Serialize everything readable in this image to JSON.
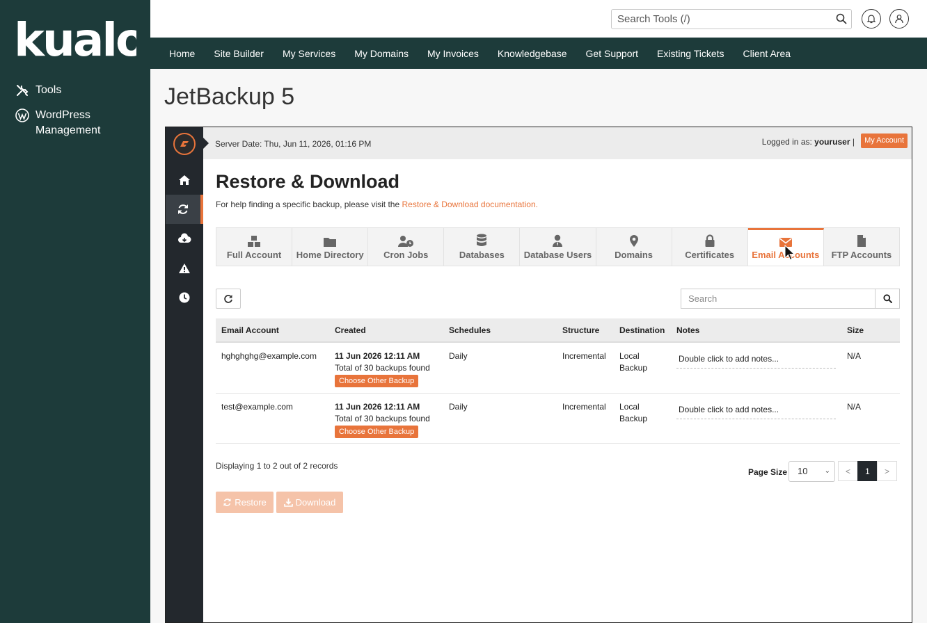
{
  "brand": {
    "logo_text": "kualo"
  },
  "sidebar": {
    "items": [
      {
        "label": "Tools",
        "icon": "tools-icon"
      },
      {
        "label": "WordPress Management",
        "icon": "wordpress-icon"
      }
    ]
  },
  "header": {
    "search_placeholder": "Search Tools (/)"
  },
  "nav": [
    "Home",
    "Site Builder",
    "My Services",
    "My Domains",
    "My Invoices",
    "Knowledgebase",
    "Get Support",
    "Existing Tickets",
    "Client Area"
  ],
  "page": {
    "title": "JetBackup 5"
  },
  "jetbackup": {
    "server_date": "Server Date: Thu, Jun 11, 2026, 01:16 PM",
    "logged_in_prefix": "Logged in as:",
    "username": "youruser",
    "separator": "|",
    "my_account": "My Account",
    "heading": "Restore & Download",
    "help_text": "For help finding a specific backup, please visit the",
    "help_link": "Restore & Download documentation.",
    "tabs": [
      {
        "label": "Full Account",
        "icon": "cubes-icon"
      },
      {
        "label": "Home Directory",
        "icon": "folder-icon"
      },
      {
        "label": "Cron Jobs",
        "icon": "user-clock-icon"
      },
      {
        "label": "Databases",
        "icon": "database-icon"
      },
      {
        "label": "Database Users",
        "icon": "user-tie-icon"
      },
      {
        "label": "Domains",
        "icon": "map-marker-icon"
      },
      {
        "label": "Certificates",
        "icon": "lock-icon"
      },
      {
        "label": "Email Accounts",
        "icon": "envelope-icon"
      },
      {
        "label": "FTP Accounts",
        "icon": "file-icon"
      }
    ],
    "active_tab": "Email Accounts",
    "search_placeholder": "Search",
    "columns": [
      "Email Account",
      "Created",
      "Schedules",
      "Structure",
      "Destination",
      "Notes",
      "Size"
    ],
    "rows": [
      {
        "account": "hghghghg@example.com",
        "created_date": "11 Jun 2026 12:11 AM",
        "created_total": "Total of 30 backups found",
        "choose_label": "Choose Other Backup",
        "schedule": "Daily",
        "structure": "Incremental",
        "destination": "Local Backup",
        "notes": "Double click to add notes...",
        "size": "N/A"
      },
      {
        "account": "test@example.com",
        "created_date": "11 Jun 2026 12:11 AM",
        "created_total": "Total of 30 backups found",
        "choose_label": "Choose Other Backup",
        "schedule": "Daily",
        "structure": "Incremental",
        "destination": "Local Backup",
        "notes": "Double click to add notes...",
        "size": "N/A"
      }
    ],
    "records_text": "Displaying 1 to 2 out of 2 records",
    "page_size_label": "Page Size",
    "page_size_value": "10",
    "pager": {
      "prev": "<",
      "current": "1",
      "next": ">"
    },
    "restore_label": "Restore",
    "download_label": "Download"
  },
  "colors": {
    "sidebar_bg": "#1d3b3a",
    "accent": "#e8743b",
    "jb_dark": "#23282d"
  }
}
